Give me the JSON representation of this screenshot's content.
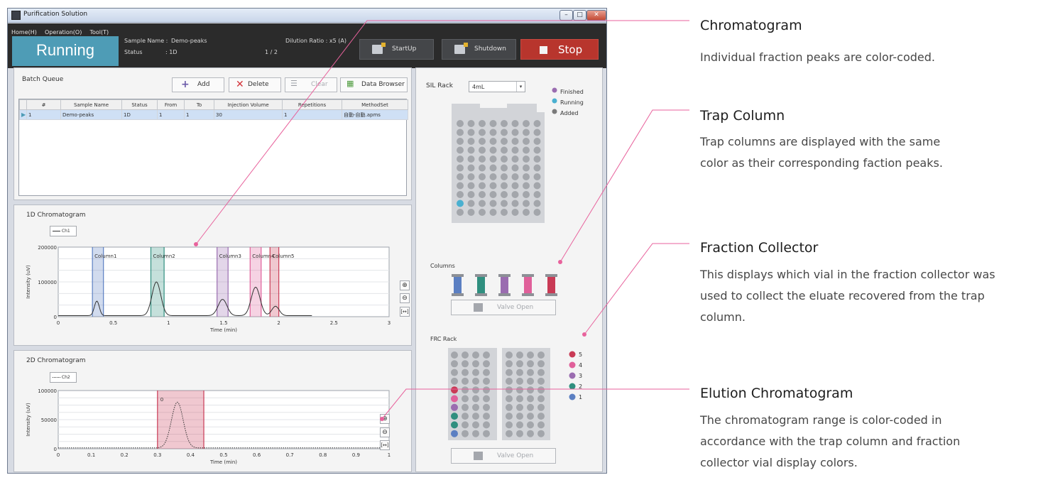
{
  "window": {
    "title": "Purification Solution"
  },
  "menu": [
    "Home(H)",
    "Operation(O)",
    "Tool(T)"
  ],
  "header": {
    "status_big": "Running",
    "sample_name_label": "Sample Name :",
    "sample_name_value": "Demo-peaks",
    "status_label": "Status",
    "status_value": ": 1D",
    "dilution": "Dilution Ratio : x5 (A)",
    "progress": "1 / 2",
    "startup": "StartUp",
    "shutdown": "Shutdown",
    "stop": "Stop"
  },
  "batch": {
    "title": "Batch Queue",
    "add": "Add",
    "delete": "Delete",
    "clear": "Clear",
    "data_browser": "Data Browser",
    "columns": [
      "#",
      "Sample Name",
      "Status",
      "From",
      "To",
      "Injection Volume",
      "Repetitions",
      "MethodSet"
    ],
    "rows": [
      [
        "1",
        "Demo-peaks",
        "1D",
        "1",
        "1",
        "30",
        "1",
        "自動-自動.apms"
      ]
    ]
  },
  "chrom1d": {
    "title": "1D Chromatogram",
    "legend": "Ch1",
    "xlabel": "Time (min)",
    "ylabel": "Intensity (uV)",
    "column_labels": [
      "Column1",
      "Column2",
      "Column3",
      "Column4",
      "Column5"
    ]
  },
  "chrom2d": {
    "title": "2D Chromatogram",
    "legend": "Ch2",
    "xlabel": "Time (min)",
    "ylabel": "Intensity (uV)",
    "peak_label": "0"
  },
  "sil": {
    "label": "SIL Rack",
    "dropdown": "4mL",
    "legend": [
      "Finished",
      "Running",
      "Added"
    ]
  },
  "columns": {
    "label": "Columns",
    "colors": [
      "#5b7fc2",
      "#2f8f7f",
      "#9a6cb0",
      "#e0609a",
      "#c93a55"
    ]
  },
  "frc": {
    "label": "FRC Rack",
    "legend": [
      "5",
      "4",
      "3",
      "2",
      "1"
    ]
  },
  "valve_open": "Valve Open",
  "colors": {
    "running": "#4e9cb6",
    "stop": "#b8352d",
    "finished": "#9a6cb0",
    "running_dot": "#4ab0d0",
    "added": "#7a7a7a",
    "col1": "#5b7fc2",
    "col2": "#2f8f7f",
    "col3": "#9a6cb0",
    "col4": "#e0609a",
    "col5": "#c93a55",
    "callout": "#e8629c"
  },
  "annotations": [
    {
      "title": "Chromatogram",
      "lines": [
        "Individual fraction peaks are color-coded."
      ]
    },
    {
      "title": "Trap Column",
      "lines": [
        "Trap columns are displayed with the same",
        "color as their corresponding faction peaks."
      ]
    },
    {
      "title": "Fraction Collector",
      "lines": [
        "This displays which vial in the fraction collector was",
        "used to collect the eluate recovered from the trap",
        "column."
      ]
    },
    {
      "title": "Elution Chromatogram",
      "lines": [
        "The chromatogram range is color-coded in",
        "accordance with the trap column and fraction",
        "collector vial display colors."
      ]
    }
  ],
  "chart_data": [
    {
      "type": "line",
      "title": "1D Chromatogram",
      "xlabel": "Time (min)",
      "ylabel": "Intensity (uV)",
      "xlim": [
        0,
        3
      ],
      "ylim": [
        0,
        200000
      ],
      "xticks": [
        "0",
        "0.5",
        "1",
        "1.5",
        "2",
        "2.5",
        "3"
      ],
      "yticks": [
        "0",
        "100000",
        "200000"
      ],
      "series": [
        {
          "name": "Ch1",
          "x": [
            0,
            0.3,
            0.35,
            0.4,
            0.8,
            0.89,
            0.98,
            1.4,
            1.49,
            1.58,
            1.7,
            1.79,
            1.88,
            1.9,
            1.97,
            2.05,
            2.3
          ],
          "y": [
            3000,
            3000,
            45000,
            3000,
            3000,
            100000,
            3000,
            3000,
            50000,
            3000,
            3000,
            85000,
            3000,
            3000,
            30000,
            3000,
            3000
          ]
        }
      ],
      "regions": [
        {
          "label": "Column1",
          "x": [
            0.31,
            0.41
          ],
          "color": "#5b7fc2"
        },
        {
          "label": "Column2",
          "x": [
            0.84,
            0.96
          ],
          "color": "#2f8f7f"
        },
        {
          "label": "Column3",
          "x": [
            1.44,
            1.54
          ],
          "color": "#9a6cb0"
        },
        {
          "label": "Column4",
          "x": [
            1.74,
            1.84
          ],
          "color": "#e0609a"
        },
        {
          "label": "Column5",
          "x": [
            1.92,
            2.0
          ],
          "color": "#c93a55"
        }
      ]
    },
    {
      "type": "line",
      "title": "2D Chromatogram",
      "xlabel": "Time (min)",
      "ylabel": "Intensity (uV)",
      "xlim": [
        0,
        1
      ],
      "ylim": [
        0,
        100000
      ],
      "xticks": [
        "0",
        "0.1",
        "0.2",
        "0.3",
        "0.4",
        "0.5",
        "0.6",
        "0.7",
        "0.8",
        "0.9",
        "1"
      ],
      "yticks": [
        "0",
        "50000",
        "100000"
      ],
      "series": [
        {
          "name": "Ch2",
          "x": [
            0,
            0.26,
            0.29,
            0.32,
            0.36,
            0.4,
            0.43,
            0.46,
            0.49,
            1.0
          ],
          "y": [
            1500,
            2000,
            15000,
            55000,
            80000,
            55000,
            15000,
            2000,
            1500,
            1500
          ]
        }
      ],
      "regions": [
        {
          "label": "0",
          "x": [
            0.3,
            0.44
          ],
          "color": "#c93a55"
        }
      ]
    }
  ]
}
